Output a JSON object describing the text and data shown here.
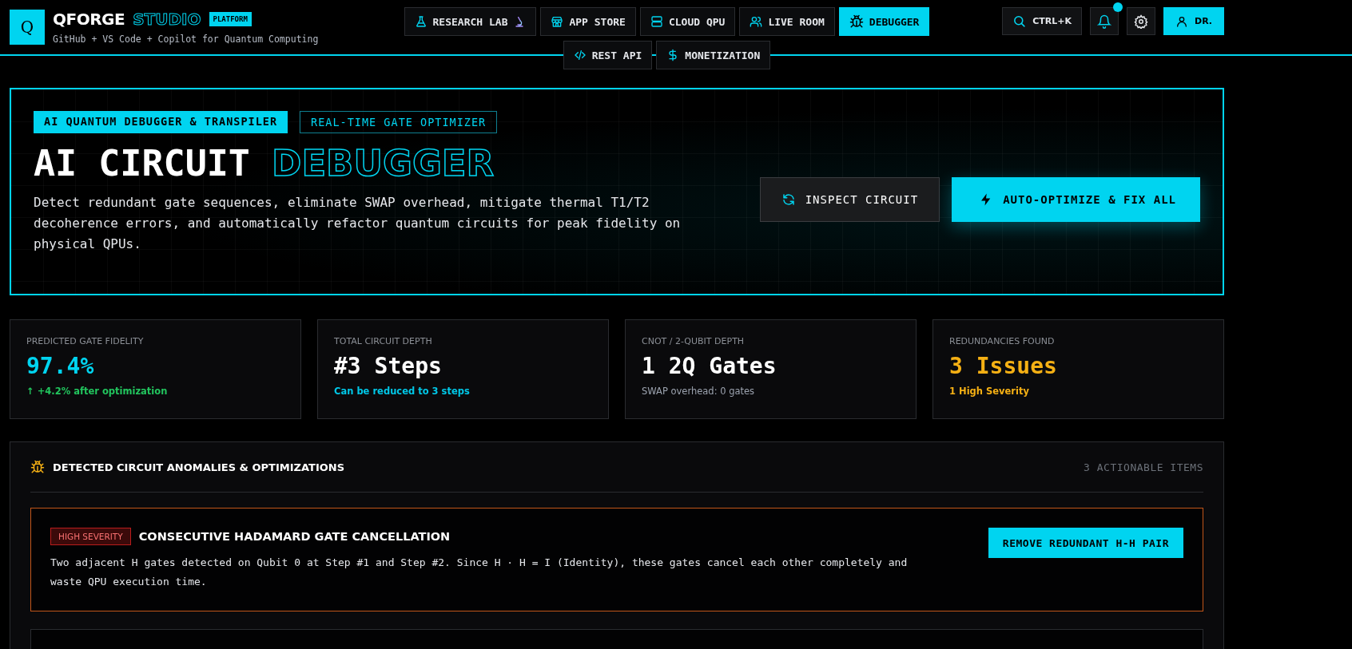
{
  "brand": {
    "logo_letter": "Q",
    "name": "QFORGE",
    "name_accent": "STUDIO",
    "badge": "PLATFORM",
    "tagline": "GitHub + VS Code + Copilot for Quantum Computing"
  },
  "nav": [
    {
      "label": "RESEARCH LAB",
      "selected": false
    },
    {
      "label": "APP STORE",
      "selected": false
    },
    {
      "label": "CLOUD QPU",
      "selected": false
    },
    {
      "label": "LIVE ROOM",
      "selected": false
    },
    {
      "label": "DEBUGGER",
      "selected": true
    },
    {
      "label": "REST API",
      "selected": false
    },
    {
      "label": "MONETIZATION",
      "selected": false
    }
  ],
  "toolbar": {
    "search_shortcut": "CTRL+K",
    "notification_unread": true,
    "user_label": "DR."
  },
  "hero": {
    "tags": [
      {
        "label": "AI QUANTUM DEBUGGER & TRANSPILER",
        "kind": "filled"
      },
      {
        "label": "REAL-TIME GATE OPTIMIZER",
        "kind": "outline"
      }
    ],
    "title": "AI CIRCUIT",
    "title_accent": "DEBUGGER",
    "description": "Detect redundant gate sequences, eliminate SWAP overhead, mitigate thermal T1/T2 decoherence errors, and automatically refactor quantum circuits for peak fidelity on physical QPUs.",
    "buttons": [
      {
        "label": "INSPECT CIRCUIT",
        "kind": "secondary"
      },
      {
        "label": "AUTO-OPTIMIZE & FIX ALL",
        "kind": "primary"
      }
    ]
  },
  "stats": [
    {
      "label": "PREDICTED GATE FIDELITY",
      "value": "97.4%",
      "note": "↑ +4.2% after optimization",
      "color": "#00d4f0",
      "kind": "positive"
    },
    {
      "label": "TOTAL CIRCUIT DEPTH",
      "value": "#3 Steps",
      "note": "Can be reduced to 3 steps",
      "color": "#ffffff",
      "kind": "info"
    },
    {
      "label": "CNOT / 2-QUBIT DEPTH",
      "value": "1 2Q Gates",
      "note": "SWAP overhead: 0 gates",
      "color": "#ffffff",
      "kind": "neutral"
    },
    {
      "label": "REDUNDANCIES FOUND",
      "value": "3 Issues",
      "note": "1 High Severity",
      "color": "#f5b014",
      "kind": "warning"
    }
  ],
  "anomalies": {
    "title": "DETECTED CIRCUIT ANOMALIES & OPTIMIZATIONS",
    "count": "3 ACTIONABLE ITEMS",
    "items": [
      {
        "kind": "high",
        "badge": "HIGH SEVERITY",
        "title": "CONSECUTIVE HADAMARD GATE CANCELLATION",
        "description": "Two adjacent H gates detected on Qubit 0 at Step #1 and Step #2. Since H · H = I (Identity), these gates cancel each other completely and waste QPU execution time.",
        "action": "REMOVE REDUNDANT H-H PAIR"
      }
    ]
  }
}
